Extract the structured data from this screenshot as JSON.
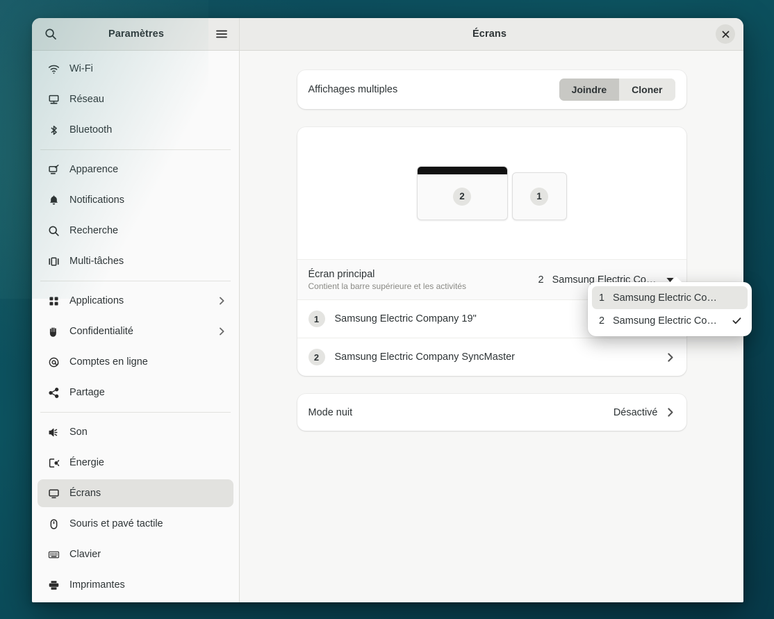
{
  "window": {
    "sidebar_header_title": "Paramètres",
    "main_header_title": "Écrans",
    "search_icon": "search-icon",
    "menu_icon": "hamburger-menu-icon",
    "close_icon": "close-icon"
  },
  "sidebar": {
    "groups": [
      {
        "items": [
          {
            "label": "Wi-Fi",
            "icon": "wifi-icon",
            "chevron": false,
            "selected": false
          },
          {
            "label": "Réseau",
            "icon": "network-icon",
            "chevron": false,
            "selected": false
          },
          {
            "label": "Bluetooth",
            "icon": "bluetooth-icon",
            "chevron": false,
            "selected": false
          }
        ]
      },
      {
        "items": [
          {
            "label": "Apparence",
            "icon": "appearance-icon",
            "chevron": false,
            "selected": false
          },
          {
            "label": "Notifications",
            "icon": "bell-icon",
            "chevron": false,
            "selected": false
          },
          {
            "label": "Recherche",
            "icon": "search-icon",
            "chevron": false,
            "selected": false
          },
          {
            "label": "Multi-tâches",
            "icon": "multitasking-icon",
            "chevron": false,
            "selected": false
          }
        ]
      },
      {
        "items": [
          {
            "label": "Applications",
            "icon": "apps-grid-icon",
            "chevron": true,
            "selected": false
          },
          {
            "label": "Confidentialité",
            "icon": "hand-privacy-icon",
            "chevron": true,
            "selected": false
          },
          {
            "label": "Comptes en ligne",
            "icon": "at-sign-icon",
            "chevron": false,
            "selected": false
          },
          {
            "label": "Partage",
            "icon": "share-icon",
            "chevron": false,
            "selected": false
          }
        ]
      },
      {
        "items": [
          {
            "label": "Son",
            "icon": "speaker-icon",
            "chevron": false,
            "selected": false
          },
          {
            "label": "Énergie",
            "icon": "power-plug-icon",
            "chevron": false,
            "selected": false
          },
          {
            "label": "Écrans",
            "icon": "display-icon",
            "chevron": false,
            "selected": true
          },
          {
            "label": "Souris et pavé tactile",
            "icon": "mouse-icon",
            "chevron": false,
            "selected": false
          },
          {
            "label": "Clavier",
            "icon": "keyboard-icon",
            "chevron": false,
            "selected": false
          },
          {
            "label": "Imprimantes",
            "icon": "printer-icon",
            "chevron": false,
            "selected": false
          }
        ]
      }
    ]
  },
  "main": {
    "multi_display": {
      "label": "Affichages multiples",
      "options": [
        {
          "label": "Joindre",
          "active": true
        },
        {
          "label": "Cloner",
          "active": false
        }
      ]
    },
    "arrangement": {
      "monitors": [
        {
          "number": "2",
          "primary": true
        },
        {
          "number": "1",
          "primary": false
        }
      ]
    },
    "primary_display": {
      "title": "Écran principal",
      "subtitle": "Contient la barre supérieure et les activités",
      "value_number": "2",
      "value_name": "Samsung Electric Co…",
      "caret_icon": "caret-down-icon"
    },
    "monitor_list": [
      {
        "number": "1",
        "name": "Samsung Electric Company 19\"",
        "chevron_icon": "chevron-right-icon"
      },
      {
        "number": "2",
        "name": "Samsung Electric Company SyncMaster",
        "chevron_icon": "chevron-right-icon"
      }
    ],
    "night_mode": {
      "label": "Mode nuit",
      "value": "Désactivé",
      "chevron_icon": "chevron-right-icon"
    }
  },
  "dropdown": {
    "items": [
      {
        "number": "1",
        "name": "Samsung Electric Co…",
        "checked": false,
        "hovered": true
      },
      {
        "number": "2",
        "name": "Samsung Electric Co…",
        "checked": true,
        "hovered": false
      }
    ],
    "check_icon": "check-icon"
  },
  "colors": {
    "desktop": "#0d5360",
    "header": "#ebebe9",
    "sidebar": "#fafafa",
    "content_bg": "#f7f7f6",
    "card": "#ffffff",
    "selection": "#e2e2df",
    "segment_active": "#c8c8c4"
  }
}
